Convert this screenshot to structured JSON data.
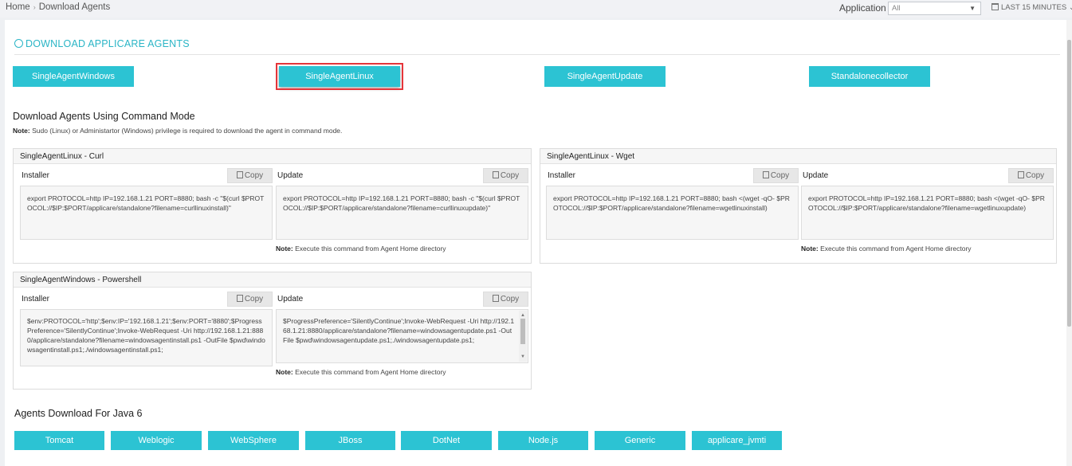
{
  "breadcrumb": {
    "home": "Home",
    "separator": "›",
    "current": "Download Agents"
  },
  "filter": {
    "label": "Application",
    "selected": "All",
    "time_range": "LAST 15 MINUTES ⌄"
  },
  "section": {
    "title": "DOWNLOAD APPLICARE AGENTS"
  },
  "agent_buttons": [
    "SingleAgentWindows",
    "SingleAgentLinux",
    "SingleAgentUpdate",
    "Standalonecollector"
  ],
  "command_mode": {
    "title": "Download Agents Using Command Mode",
    "note_label": "Note:",
    "note_text": " Sudo (Linux) or Administartor (Windows) privilege is required to download the agent in command mode."
  },
  "labels": {
    "installer": "Installer",
    "update": "Update",
    "copy": "Copy",
    "note_label": "Note:",
    "exec_note": " Execute this command from Agent Home directory"
  },
  "cards": {
    "curl": {
      "title": "SingleAgentLinux - Curl",
      "installer": "export PROTOCOL=http IP=192.168.1.21 PORT=8880; bash -c \"$(curl $PROTOCOL://$IP:$PORT/applicare/standalone?filename=curllinuxinstall)\"",
      "update": "export PROTOCOL=http IP=192.168.1.21 PORT=8880; bash -c \"$(curl $PROTOCOL://$IP:$PORT/applicare/standalone?filename=curllinuxupdate)\""
    },
    "wget": {
      "title": "SingleAgentLinux - Wget",
      "installer": "export PROTOCOL=http IP=192.168.1.21 PORT=8880; bash <(wget -qO- $PROTOCOL://$IP:$PORT/applicare/standalone?filename=wgetlinuxinstall)",
      "update": "export PROTOCOL=http IP=192.168.1.21 PORT=8880; bash <(wget -qO- $PROTOCOL://$IP:$PORT/applicare/standalone?filename=wgetlinuxupdate)"
    },
    "powershell": {
      "title": "SingleAgentWindows - Powershell",
      "installer": "$env:PROTOCOL='http';$env:IP='192.168.1.21';$env:PORT='8880';$ProgressPreference='SilentlyContinue';Invoke-WebRequest -Uri http://192.168.1.21:8880/applicare/standalone?filename=windowsagentinstall.ps1 -OutFile $pwd\\windowsagentinstall.ps1;./windowsagentinstall.ps1;",
      "update": "$ProgressPreference='SilentlyContinue';Invoke-WebRequest -Uri http://192.168.1.21:8880/applicare/standalone?filename=windowsagentupdate.ps1 -OutFile $pwd\\windowsagentupdate.ps1;./windowsagentupdate.ps1;"
    }
  },
  "java6": {
    "title": "Agents Download For Java 6",
    "buttons": [
      "Tomcat",
      "Weblogic",
      "WebSphere",
      "JBoss",
      "DotNet",
      "Node.js",
      "Generic",
      "applicare_jvmti"
    ]
  },
  "colors": {
    "accent": "#2cc3d3",
    "highlight": "#e5353a"
  }
}
